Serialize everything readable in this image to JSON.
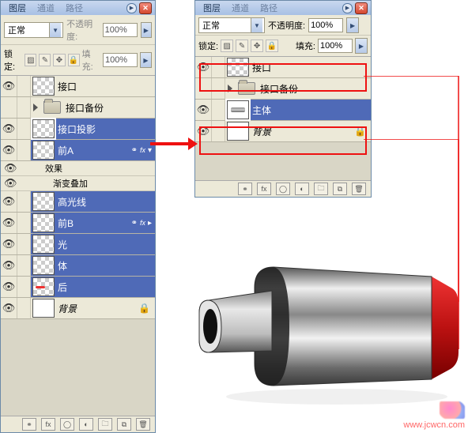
{
  "left_panel": {
    "tabs": {
      "layers": "图层",
      "channels": "通道",
      "paths": "路径"
    },
    "blend_label": "正常",
    "opacity_label": "不透明度:",
    "opacity_value": "100%",
    "lock_label": "锁定:",
    "fill_label": "填充:",
    "fill_value": "100%",
    "layers": [
      {
        "name": "接口",
        "visible": true,
        "thumb": "checker"
      },
      {
        "name": "接口备份",
        "type": "group",
        "visible": false
      },
      {
        "name": "接口投影",
        "visible": true,
        "thumb": "checker",
        "selected": true,
        "halo": true
      },
      {
        "name": "前A",
        "visible": true,
        "thumb": "checker",
        "fx": true,
        "open": true,
        "effects_label": "效果",
        "effects": [
          "渐变叠加"
        ]
      },
      {
        "name": "高光线",
        "visible": true,
        "thumb": "checker"
      },
      {
        "name": "前B",
        "visible": true,
        "thumb": "checker",
        "fx": true
      },
      {
        "name": "光",
        "visible": true,
        "thumb": "checker"
      },
      {
        "name": "体",
        "visible": true,
        "thumb": "checker"
      },
      {
        "name": "后",
        "visible": true,
        "thumb": "checker"
      },
      {
        "name": "背景",
        "visible": true,
        "thumb": "white",
        "locked": true,
        "italic": true
      }
    ]
  },
  "right_panel": {
    "tabs": {
      "layers": "图层",
      "channels": "通道",
      "paths": "路径"
    },
    "blend_label": "正常",
    "opacity_label": "不透明度:",
    "opacity_value": "100%",
    "lock_label": "锁定:",
    "fill_label": "填充:",
    "fill_value": "100%",
    "layers": [
      {
        "name": "接口",
        "visible": true,
        "thumb": "checker"
      },
      {
        "name": "接口备份",
        "type": "group",
        "visible": false
      },
      {
        "name": "主体",
        "visible": true,
        "thumb": "usb",
        "selected": true,
        "halo": true
      },
      {
        "name": "背景",
        "visible": true,
        "thumb": "white",
        "locked": true,
        "italic": true
      }
    ]
  },
  "watermark": "www.jcwcn.com"
}
